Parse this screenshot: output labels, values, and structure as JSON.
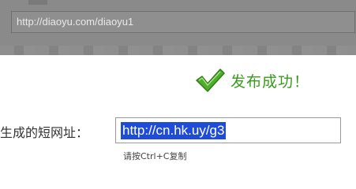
{
  "background": {
    "url_field_value": "http://diaoyu.com/diaoyu1"
  },
  "dialog": {
    "success_icon": "checkmark-icon",
    "success_message": "发布成功！",
    "short_url_label": "生成的短网址：",
    "short_url_value": "http://cn.hk.uy/g3",
    "copy_hint": "请按Ctrl+C复制"
  },
  "colors": {
    "success_green": "#3a9a1e",
    "selection_blue": "#1e4bd8",
    "overlay_gray": "#8a8a8a"
  }
}
